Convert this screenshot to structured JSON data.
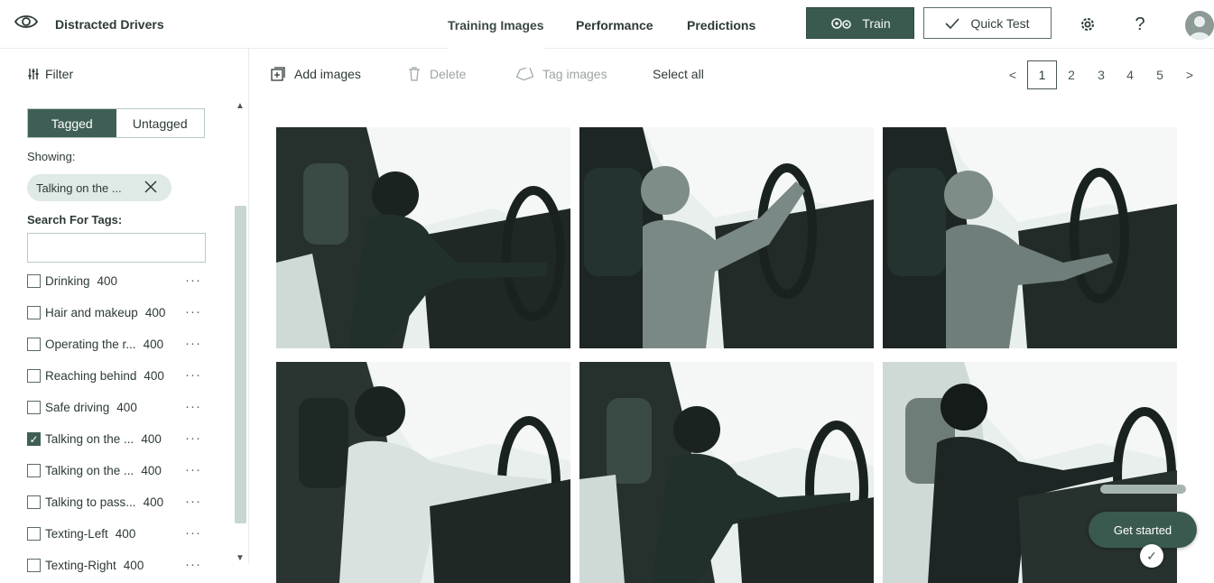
{
  "app": {
    "title": "Distracted Drivers"
  },
  "nav": {
    "tabs": [
      {
        "label": "Training Images",
        "active": true
      },
      {
        "label": "Performance",
        "active": false
      },
      {
        "label": "Predictions",
        "active": false
      }
    ]
  },
  "header_buttons": {
    "train_label": "Train",
    "quick_test_label": "Quick Test",
    "help_glyph": "?"
  },
  "sidebar": {
    "filter_label": "Filter",
    "segment": {
      "tagged": "Tagged",
      "untagged": "Untagged",
      "selected": "Tagged"
    },
    "showing_label": "Showing:",
    "active_filter": "Talking on the ...",
    "search_label": "Search For Tags:",
    "search_value": "",
    "tags": [
      {
        "name": "Drinking",
        "count": "400",
        "checked": false
      },
      {
        "name": "Hair and makeup",
        "count": "400",
        "checked": false
      },
      {
        "name": "Operating the r...",
        "count": "400",
        "checked": false
      },
      {
        "name": "Reaching behind",
        "count": "400",
        "checked": false
      },
      {
        "name": "Safe driving",
        "count": "400",
        "checked": false
      },
      {
        "name": "Talking on the ...",
        "count": "400",
        "checked": true
      },
      {
        "name": "Talking on the ...",
        "count": "400",
        "checked": false
      },
      {
        "name": "Talking to pass...",
        "count": "400",
        "checked": false
      },
      {
        "name": "Texting-Left",
        "count": "400",
        "checked": false
      },
      {
        "name": "Texting-Right",
        "count": "400",
        "checked": false
      }
    ]
  },
  "toolbar": {
    "add_images": "Add images",
    "delete": "Delete",
    "tag_images": "Tag images",
    "select_all": "Select all"
  },
  "pagination": {
    "prev": "<",
    "pages": [
      "1",
      "2",
      "3",
      "4",
      "5"
    ],
    "current": "1",
    "next": ">"
  },
  "images": [
    {
      "alt": "woman driver talking on phone"
    },
    {
      "alt": "older driver talking on phone"
    },
    {
      "alt": "older driver talking on phone, steering"
    },
    {
      "alt": "man driver talking on phone"
    },
    {
      "alt": "woman driver talking on phone"
    },
    {
      "alt": "man with glasses talking on phone"
    }
  ],
  "help_widget": {
    "label": "Get started"
  },
  "colors": {
    "accent": "#3b5a4f",
    "chip": "#dfe9e6",
    "segment_on": "#3f5f56"
  }
}
